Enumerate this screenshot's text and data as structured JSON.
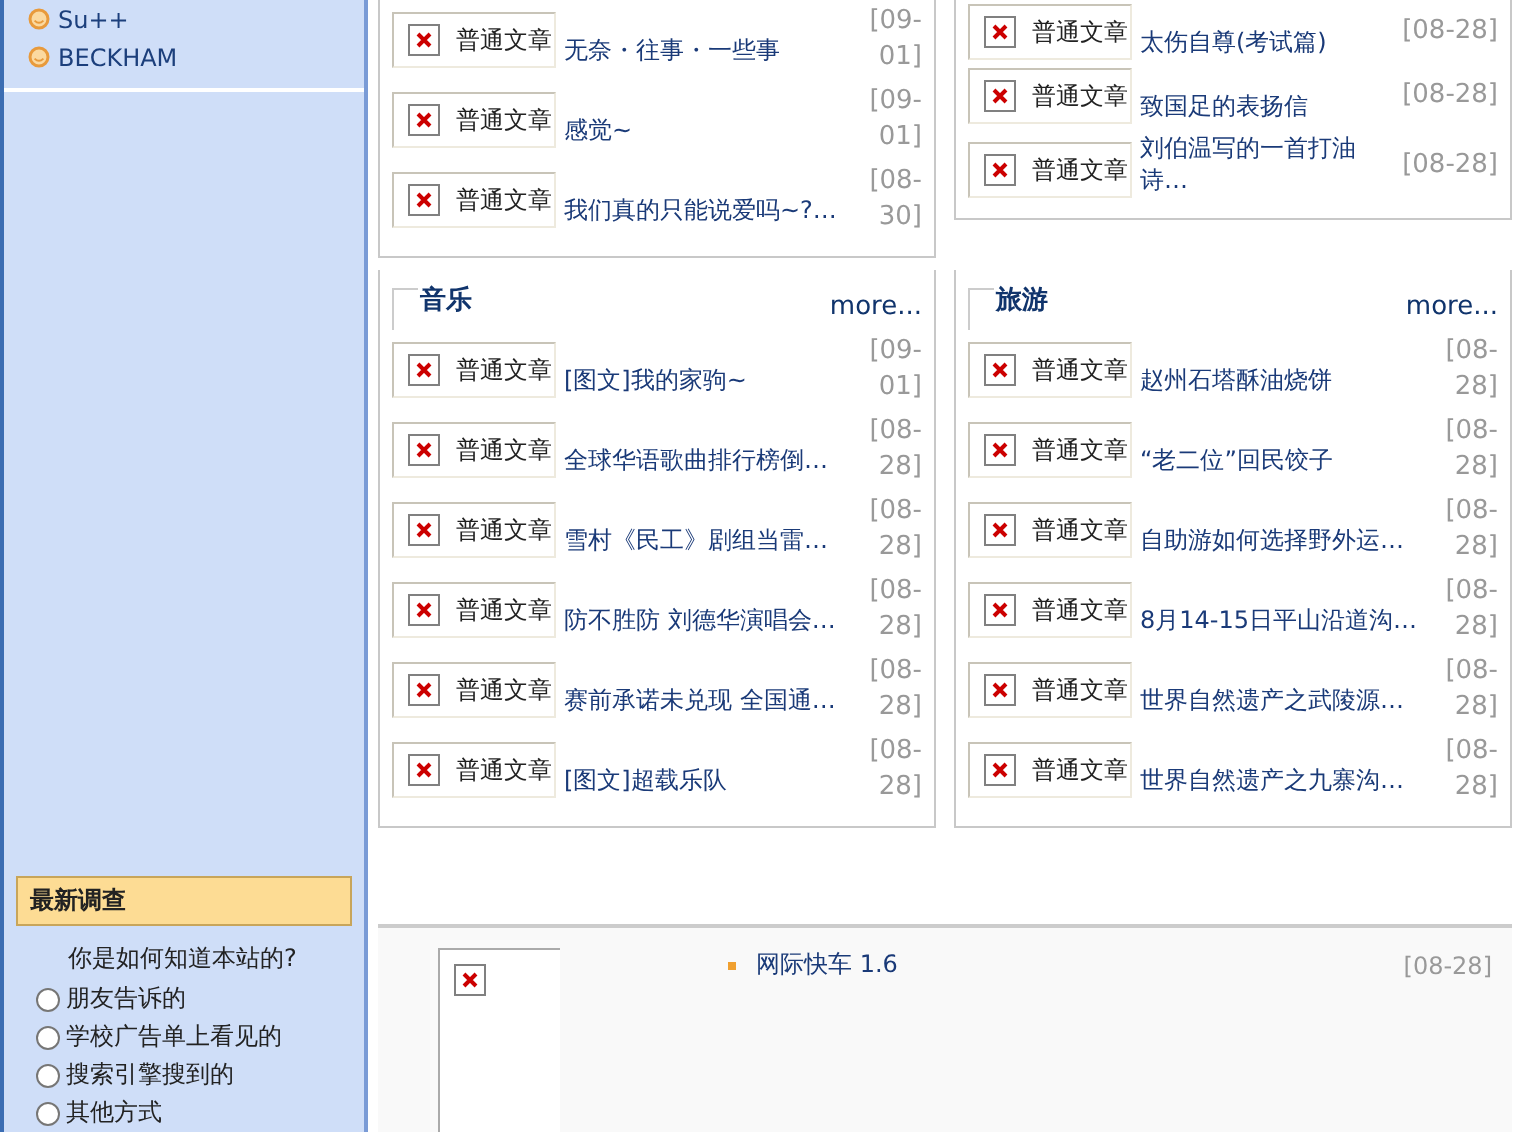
{
  "sidebar": {
    "links": [
      {
        "label": "Su++"
      },
      {
        "label": "BECKHAM"
      }
    ],
    "poll": {
      "title": "最新调查",
      "question": "你是如何知道本站的?",
      "options": [
        {
          "label": "朋友告诉的",
          "selected": false
        },
        {
          "label": "学校广告单上看见的",
          "selected": false
        },
        {
          "label": "搜索引擎搜到的",
          "selected": false
        },
        {
          "label": "其他方式",
          "selected": false
        }
      ]
    }
  },
  "top_boxes": [
    {
      "items": [
        {
          "badge": "普通文章",
          "title": "无奈・往事・一些事",
          "date": "[09-01]"
        },
        {
          "badge": "普通文章",
          "title": "感觉~",
          "date": "[09-01]"
        },
        {
          "badge": "普通文章",
          "title": "我们真的只能说爱吗~?…",
          "date": "[08-30]"
        }
      ]
    },
    {
      "items": [
        {
          "badge": "普通文章",
          "title": "太伤自尊(考试篇)",
          "date": "[08-28]"
        },
        {
          "badge": "普通文章",
          "title": "致国足的表扬信",
          "date": "[08-28]"
        },
        {
          "badge": "普通文章",
          "title": "刘伯温写的一首打油诗…",
          "date": "[08-28]"
        }
      ]
    }
  ],
  "category_boxes": [
    {
      "title": "音乐",
      "more": "more...",
      "items": [
        {
          "badge": "普通文章",
          "title": "[图文]我的家驹~",
          "date": "[09-01]"
        },
        {
          "badge": "普通文章",
          "title": "全球华语歌曲排行榜倒…",
          "date": "[08-28]"
        },
        {
          "badge": "普通文章",
          "title": "雪村《民工》剧组当雷…",
          "date": "[08-28]"
        },
        {
          "badge": "普通文章",
          "title": "防不胜防 刘德华演唱会…",
          "date": "[08-28]"
        },
        {
          "badge": "普通文章",
          "title": "赛前承诺未兑现 全国通…",
          "date": "[08-28]"
        },
        {
          "badge": "普通文章",
          "title": "[图文]超载乐队",
          "date": "[08-28]"
        }
      ]
    },
    {
      "title": "旅游",
      "more": "more...",
      "items": [
        {
          "badge": "普通文章",
          "title": "赵州石塔酥油烧饼",
          "date": "[08-28]"
        },
        {
          "badge": "普通文章",
          "title": "“老二位”回民饺子",
          "date": "[08-28]"
        },
        {
          "badge": "普通文章",
          "title": "自助游如何选择野外运…",
          "date": "[08-28]"
        },
        {
          "badge": "普通文章",
          "title": "8月14-15日平山沿道沟…",
          "date": "[08-28]"
        },
        {
          "badge": "普通文章",
          "title": "世界自然遗产之武陵源…",
          "date": "[08-28]"
        },
        {
          "badge": "普通文章",
          "title": "世界自然遗产之九寨沟…",
          "date": "[08-28]"
        }
      ]
    }
  ],
  "bottom": {
    "items": [
      {
        "title": "网际快车 1.6",
        "date": "[08-28]"
      }
    ]
  }
}
